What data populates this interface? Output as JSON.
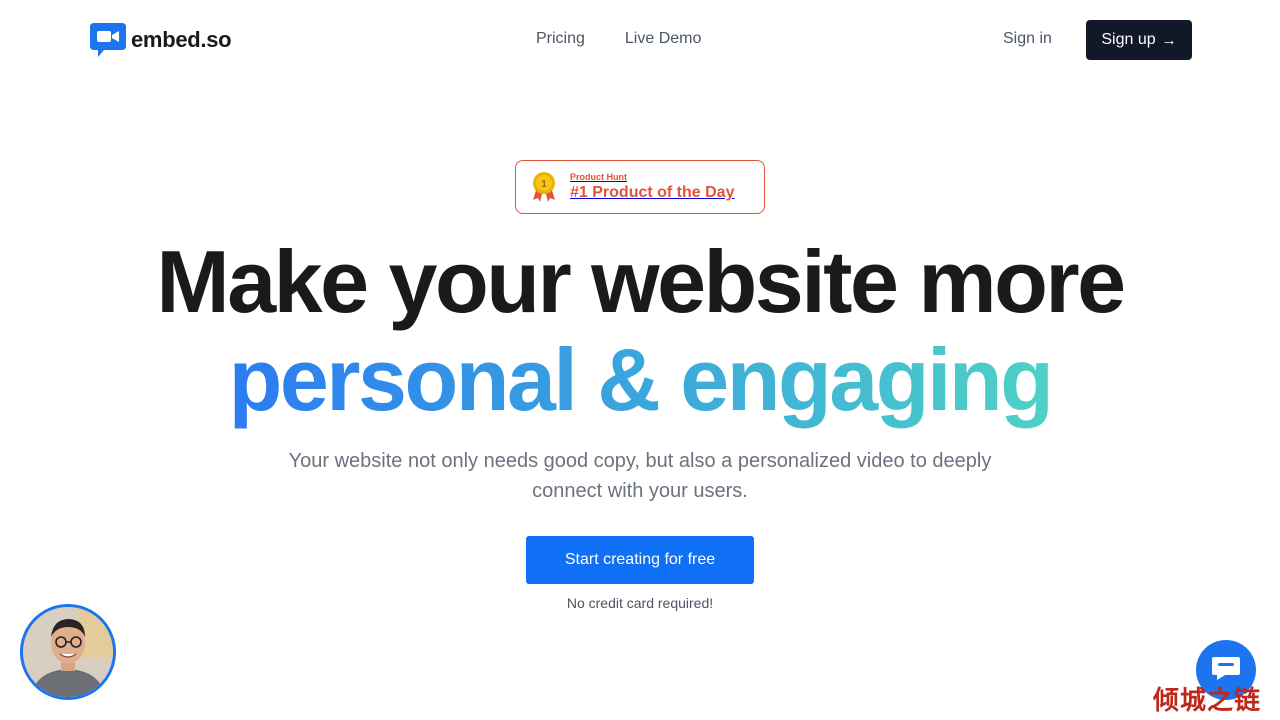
{
  "header": {
    "brand": "embed.so",
    "nav": [
      {
        "label": "Pricing"
      },
      {
        "label": "Live Demo"
      }
    ],
    "signin_label": "Sign in",
    "signup_label": "Sign up",
    "signup_icon": "arrow-right-icon"
  },
  "badge": {
    "small": "Product Hunt",
    "big": "#1 Product of the Day",
    "icon": "medal-icon",
    "color": "#e2533a"
  },
  "hero": {
    "line1": "Make your website more",
    "line2": "personal & engaging",
    "subtitle": "Your website not only needs good copy, but also a personalized video to deeply connect with your users.",
    "cta_label": "Start creating for free",
    "note": "No credit card required!"
  },
  "colors": {
    "accent": "#0f6ff5",
    "dark_button": "#111827",
    "gradient_start": "#2b7cf0",
    "gradient_end": "#4fd1c5"
  },
  "widgets": {
    "avatar_icon": "person-avatar",
    "chat_icon": "chat-bubble-icon"
  },
  "watermark": "倾城之链"
}
